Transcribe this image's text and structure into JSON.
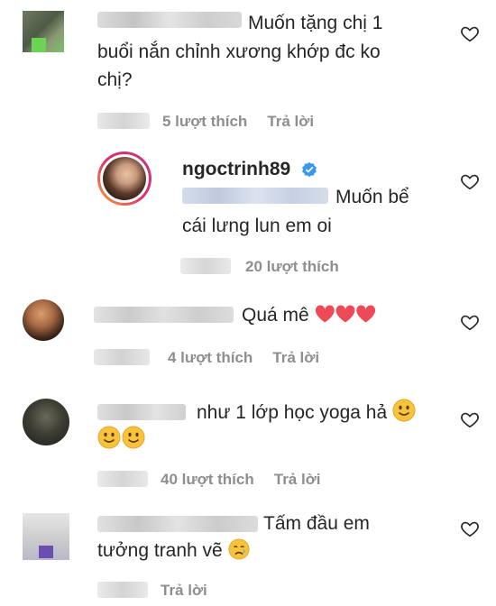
{
  "comments": [
    {
      "text_line1": "Muốn tặng chị 1",
      "text_line2": "buổi nắn chỉnh xương khớp đc ko",
      "text_line3": "chị?",
      "likes": "5 lượt thích",
      "reply": "Trả lời"
    },
    {
      "text": "Quá mê",
      "likes": "4 lượt thích",
      "reply": "Trả lời"
    },
    {
      "text_line1": "như 1 lớp học yoga hả",
      "likes": "40 lượt thích",
      "reply": "Trả lời"
    },
    {
      "text_line1": "Tấm đầu em",
      "text_line2": "tưởng tranh vẽ",
      "reply": "Trả lời"
    }
  ],
  "reply_thread": {
    "username": "ngoctrinh89",
    "text_line1": "Muốn bể",
    "text_line2": "cái lưng lun em oi",
    "likes": "20 lượt thích"
  },
  "icons": {
    "heart": "heart-outline-icon",
    "verified": "verified-badge-icon"
  },
  "colors": {
    "meta": "#8e8e8e",
    "verified": "#3897f0",
    "heart_emoji": "#ed4956"
  }
}
